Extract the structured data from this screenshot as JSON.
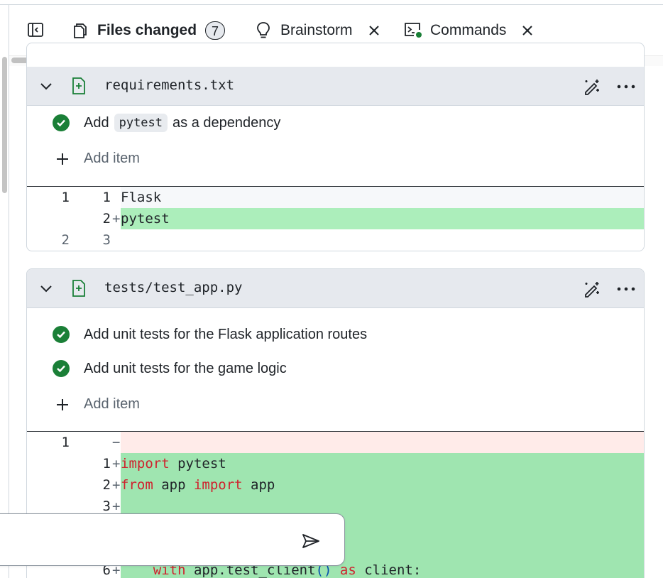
{
  "tabs": [
    {
      "label": "Files changed",
      "count": "7",
      "icon": "file-diff-icon",
      "active": true
    },
    {
      "label": "Brainstorm",
      "icon": "lightbulb-icon",
      "closable": true
    },
    {
      "label": "Commands",
      "icon": "terminal-icon",
      "closable": true
    }
  ],
  "files": [
    {
      "name": "requirements.txt",
      "tasks": [
        {
          "prefix": "Add",
          "code": "pytest",
          "suffix": "as a dependency",
          "done": true
        }
      ],
      "add_item_label": "Add item",
      "diff": [
        {
          "old": "1",
          "new": "1",
          "sign": "",
          "code": "Flask",
          "type": "ctx"
        },
        {
          "old": "",
          "new": "2",
          "sign": "+",
          "code": "pytest",
          "type": "add"
        },
        {
          "old": "2",
          "new": "3",
          "sign": "",
          "code": "",
          "type": "plain"
        }
      ]
    },
    {
      "name": "tests/test_app.py",
      "tasks": [
        {
          "text": "Add unit tests for the Flask application routes",
          "done": true
        },
        {
          "text": "Add unit tests for the game logic",
          "done": true
        }
      ],
      "add_item_label": "Add item",
      "diff": [
        {
          "old": "1",
          "new": "",
          "sign": "−",
          "code": "",
          "type": "del"
        },
        {
          "old": "",
          "new": "1",
          "sign": "+",
          "kw1": "import",
          "rest1": " pytest",
          "type": "add"
        },
        {
          "old": "",
          "new": "2",
          "sign": "+",
          "kw1": "from",
          "rest1": " app ",
          "kw2": "import",
          "rest2": " app",
          "type": "add"
        },
        {
          "old": "",
          "new": "3",
          "sign": "+",
          "code": "",
          "type": "add"
        },
        {
          "old": "",
          "new": "6",
          "sign": "+",
          "indent": "    ",
          "kw1": "with",
          "rest1": " app.test_client",
          "paren": "()",
          "kw2": " as",
          "rest2": " client:",
          "type": "add"
        }
      ]
    }
  ],
  "composer": {
    "placeholder": "",
    "send_icon": "send-icon"
  },
  "colors": {
    "accent_underline": "#cf222e",
    "check_green": "#1a7f37",
    "add_bg": "#aceebb",
    "del_bg": "#ffebe9",
    "keyword": "#cf222e"
  }
}
